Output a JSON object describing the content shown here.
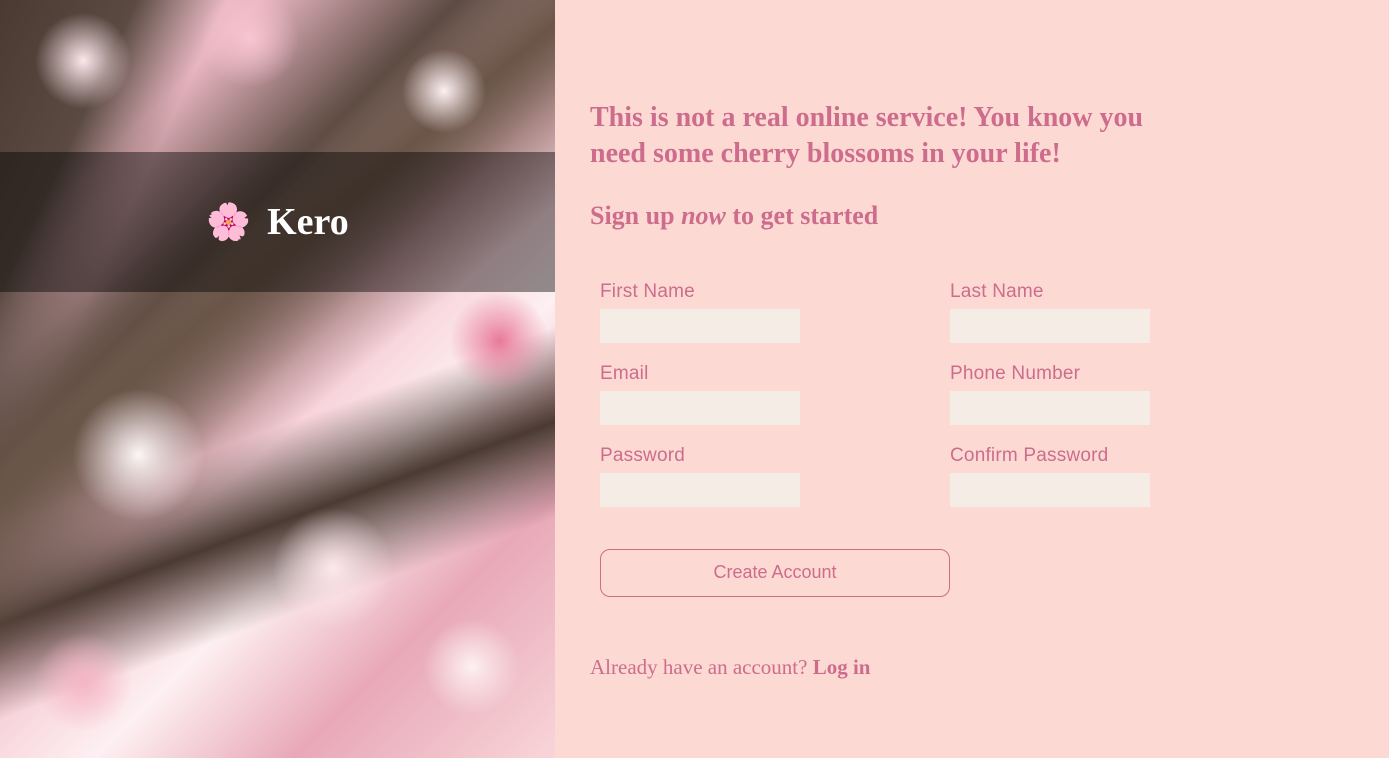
{
  "brand": {
    "icon": "🌸",
    "name": "Kero"
  },
  "headline": "This is not a real online service! You know you need some cherry blossoms in your life!",
  "subhead": {
    "prefix": "Sign up ",
    "emphasis": "now",
    "suffix": " to get started"
  },
  "form": {
    "fields": {
      "first_name": {
        "label": "First Name",
        "value": ""
      },
      "last_name": {
        "label": "Last Name",
        "value": ""
      },
      "email": {
        "label": "Email",
        "value": ""
      },
      "phone": {
        "label": "Phone Number",
        "value": ""
      },
      "password": {
        "label": "Password",
        "value": ""
      },
      "confirm_password": {
        "label": "Confirm Password",
        "value": ""
      }
    },
    "submit_label": "Create Account"
  },
  "login_prompt": {
    "text": "Already have an account? ",
    "link": "Log in"
  },
  "colors": {
    "background": "#fcdad3",
    "accent": "#cd6c8c",
    "input_bg": "#f5ece6"
  }
}
